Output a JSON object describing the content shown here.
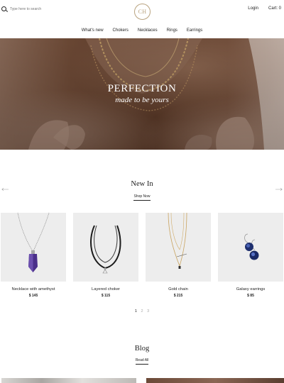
{
  "header": {
    "search_placeholder": "Type here to search",
    "logo_text": "CH",
    "login_label": "Login",
    "cart_label": "Cart: 0"
  },
  "nav": {
    "items": [
      "What's new",
      "Chokers",
      "Necklaces",
      "Rings",
      "Earrings"
    ]
  },
  "hero": {
    "title": "PERFECTION",
    "subtitle": "made to be yours"
  },
  "new_in": {
    "title": "New In",
    "link_label": "Shop Now",
    "products": [
      {
        "name": "Necklace with amethyst",
        "price": "$ 145",
        "icon": "amethyst-necklace-image"
      },
      {
        "name": "Layered choker",
        "price": "$ 115",
        "icon": "layered-choker-image"
      },
      {
        "name": "Gold chain",
        "price": "$ 215",
        "icon": "gold-chain-image"
      },
      {
        "name": "Galaxy earrings",
        "price": "$ 85",
        "icon": "galaxy-earrings-image"
      }
    ]
  },
  "pagination": {
    "pages": [
      "1",
      "2",
      "3"
    ],
    "current": "1"
  },
  "blog": {
    "title": "Blog",
    "link_label": "Read All"
  },
  "colors": {
    "accent": "#b9a37f",
    "hero_brown": "#6e4a36",
    "card_background": "#ededed"
  }
}
